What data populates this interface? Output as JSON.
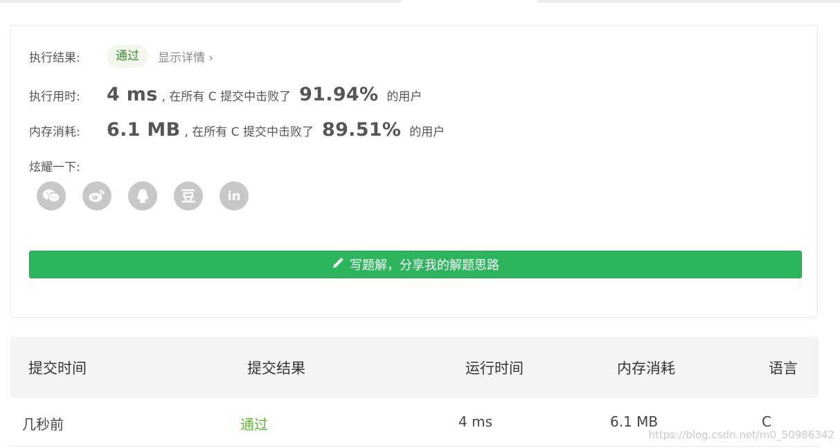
{
  "result": {
    "label": "执行结果:",
    "status": "通过",
    "details_link": "显示详情 ›"
  },
  "runtime": {
    "label": "执行用时:",
    "value": "4 ms",
    "middle_text": ", 在所有 C 提交中击败了",
    "percent": "91.94%",
    "suffix": "的用户"
  },
  "memory": {
    "label": "内存消耗:",
    "value": "6.1 MB",
    "middle_text": ", 在所有 C 提交中击败了",
    "percent": "89.51%",
    "suffix": "的用户"
  },
  "share": {
    "label": "炫耀一下:",
    "icons": [
      "wechat-icon",
      "weibo-icon",
      "qq-icon",
      "douban-icon",
      "linkedin-icon"
    ],
    "douban_glyph": "豆",
    "linkedin_glyph": "in"
  },
  "write_button": {
    "label": "写题解，分享我的解题思路",
    "icon": "pencil-icon"
  },
  "table": {
    "headers": [
      "提交时间",
      "提交结果",
      "运行时间",
      "内存消耗",
      "语言"
    ],
    "rows": [
      [
        "几秒前",
        "通过",
        "4 ms",
        "6.1 MB",
        "C"
      ]
    ]
  },
  "watermark": "https://blog.csdn.net/m0_50986342",
  "colors": {
    "accent_green": "#2db55d",
    "status_green": "#5cb82f",
    "icon_gray": "#c7c7c7"
  }
}
